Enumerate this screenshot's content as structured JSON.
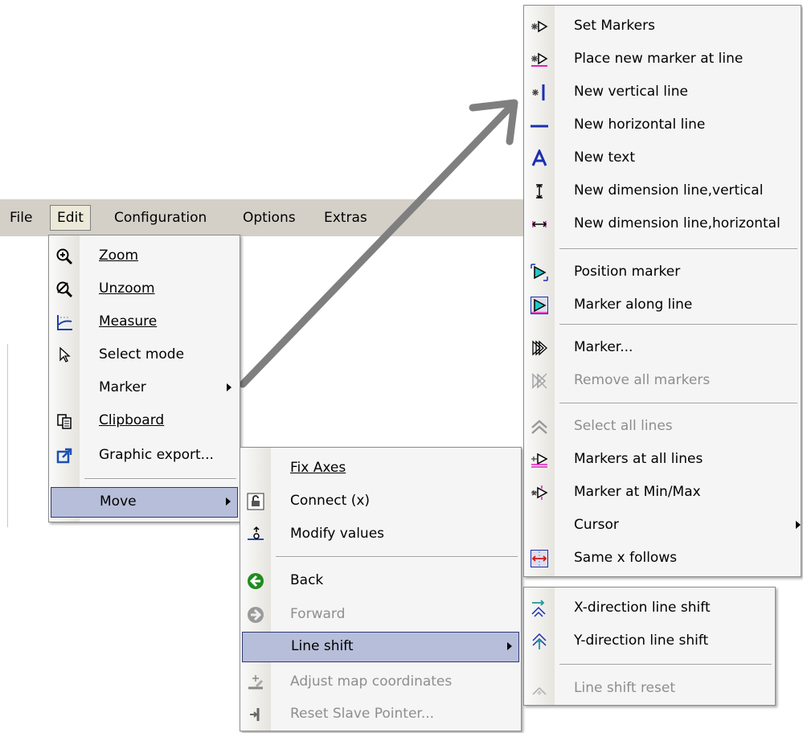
{
  "menubar": {
    "items": [
      "File",
      "Edit",
      "Configuration",
      "Options",
      "Extras"
    ]
  },
  "edit_menu": {
    "items": [
      {
        "label": "Zoom",
        "icon": "zoom-in-icon"
      },
      {
        "label": "Unzoom",
        "icon": "zoom-out-icon"
      },
      {
        "label": "Measure",
        "icon": "measure-icon"
      },
      {
        "label": "Select mode",
        "icon": "cursor-icon"
      },
      {
        "label": "Marker",
        "submenu": true
      },
      {
        "label": "Clipboard",
        "icon": "clipboard-icon"
      },
      {
        "label": "Graphic export...",
        "icon": "export-icon"
      },
      {
        "label": "Move",
        "submenu": true,
        "highlighted": true
      }
    ]
  },
  "move_menu": {
    "items": [
      {
        "label": "Fix Axes"
      },
      {
        "label": "Connect (x)",
        "icon": "connect-icon"
      },
      {
        "label": "Modify values",
        "icon": "modify-values-icon"
      },
      {
        "label": "Back",
        "icon": "back-icon"
      },
      {
        "label": "Forward",
        "icon": "forward-icon",
        "disabled": true
      },
      {
        "label": "Line shift",
        "submenu": true,
        "highlighted": true
      },
      {
        "label": "Adjust map coordinates",
        "icon": "adjust-map-icon",
        "disabled": true
      },
      {
        "label": "Reset Slave Pointer...",
        "icon": "reset-pointer-icon",
        "disabled": true
      }
    ]
  },
  "marker_menu": {
    "items": [
      {
        "label": "Set Markers",
        "icon": "set-markers-icon"
      },
      {
        "label": "Place new marker at line",
        "icon": "place-marker-icon"
      },
      {
        "label": "New vertical line",
        "icon": "vertical-line-icon"
      },
      {
        "label": "New horizontal line",
        "icon": "horizontal-line-icon"
      },
      {
        "label": "New text",
        "icon": "text-icon"
      },
      {
        "label": "New dimension line,vertical",
        "icon": "dimension-vertical-icon"
      },
      {
        "label": "New dimension line,horizontal",
        "icon": "dimension-horizontal-icon"
      },
      {
        "label": "Position marker",
        "icon": "position-marker-icon"
      },
      {
        "label": "Marker along line",
        "icon": "marker-along-line-icon"
      },
      {
        "label": "Marker...",
        "icon": "marker-dialog-icon"
      },
      {
        "label": "Remove all markers",
        "icon": "remove-markers-icon",
        "disabled": true
      },
      {
        "label": "Select all lines",
        "icon": "select-lines-icon",
        "disabled": true
      },
      {
        "label": "Markers at all lines",
        "icon": "markers-all-lines-icon"
      },
      {
        "label": "Marker at Min/Max",
        "icon": "marker-minmax-icon"
      },
      {
        "label": "Cursor",
        "submenu": true
      },
      {
        "label": "Same x follows",
        "icon": "same-x-icon"
      }
    ]
  },
  "lineshift_menu": {
    "items": [
      {
        "label": "X-direction line shift",
        "icon": "x-shift-icon"
      },
      {
        "label": "Y-direction line shift",
        "icon": "y-shift-icon"
      },
      {
        "label": "Line shift reset",
        "icon": "shift-reset-icon",
        "disabled": true
      }
    ]
  },
  "colors": {
    "menubar": "#d4d0c8",
    "menu_bg": "#f5f5f5",
    "highlight": "#b7bed9",
    "highlight_border": "#2d3a74",
    "disabled_text": "#8e8e8e",
    "arrow": "#7f7f7f"
  }
}
